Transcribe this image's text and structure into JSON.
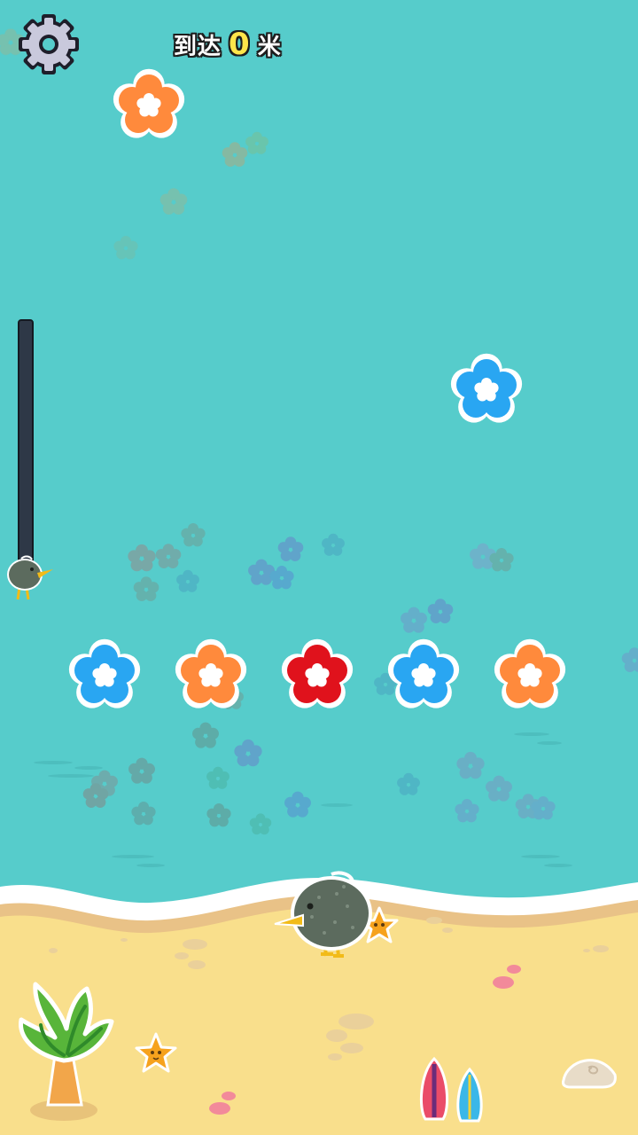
{
  "hud": {
    "prefix": "到达",
    "distance": "0",
    "unit": "米"
  },
  "icons": {
    "settings": "gear-icon",
    "player": "kiwi-bird",
    "progress_marker": "kiwi-bird"
  },
  "progress": {
    "fraction": 0.0
  },
  "colors": {
    "sea": "#56cccb",
    "sand": "#f9df8c",
    "foam": "#ffffff",
    "flower_orange": "#ff8a3c",
    "flower_blue": "#29a6f2",
    "flower_red": "#e0121c",
    "kiwi_body": "#5c6b5e",
    "beak": "#f2bb18"
  },
  "flowers": {
    "top": [
      {
        "color": "orange",
        "state": "active"
      },
      {
        "color": "blue",
        "state": "active"
      }
    ],
    "row": [
      {
        "color": "blue"
      },
      {
        "color": "orange"
      },
      {
        "color": "red"
      },
      {
        "color": "blue"
      },
      {
        "color": "orange"
      }
    ]
  }
}
